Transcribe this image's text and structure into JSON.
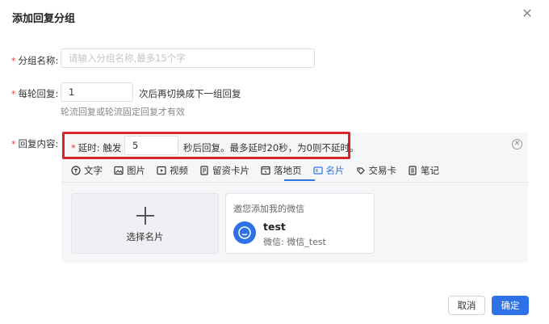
{
  "dialog": {
    "title": "添加回复分组"
  },
  "group_name": {
    "label": "分组名称:",
    "placeholder": "请输入分组名称,最多15个字"
  },
  "per_round": {
    "label": "每轮回复:",
    "value": "1",
    "suffix": "次后再切换成下一组回复",
    "note": "轮流回复或轮流固定回复才有效"
  },
  "reply_content": {
    "label": "回复内容:",
    "delay_prefix": "延时: 触发",
    "delay_value": "5",
    "delay_suffix": "秒后回复。最多延时20秒，为0则不延时。"
  },
  "tabs": [
    {
      "label": "文字",
      "icon": "text-icon"
    },
    {
      "label": "图片",
      "icon": "image-icon"
    },
    {
      "label": "视频",
      "icon": "video-icon"
    },
    {
      "label": "留资卡片",
      "icon": "lead-card-icon"
    },
    {
      "label": "落地页",
      "icon": "landing-page-icon"
    },
    {
      "label": "名片",
      "icon": "business-card-icon"
    },
    {
      "label": "交易卡",
      "icon": "trade-card-icon"
    },
    {
      "label": "笔记",
      "icon": "note-icon"
    }
  ],
  "active_tab": "名片",
  "select_card": {
    "label": "选择名片"
  },
  "wechat_card": {
    "invite": "邀您添加我的微信",
    "name": "test",
    "id": "微信: 微信_test"
  },
  "buttons": {
    "cancel": "取消",
    "ok": "确定"
  },
  "colors": {
    "primary": "#2f72e8",
    "highlight_border": "#d9232d",
    "required": "#e4393c"
  }
}
